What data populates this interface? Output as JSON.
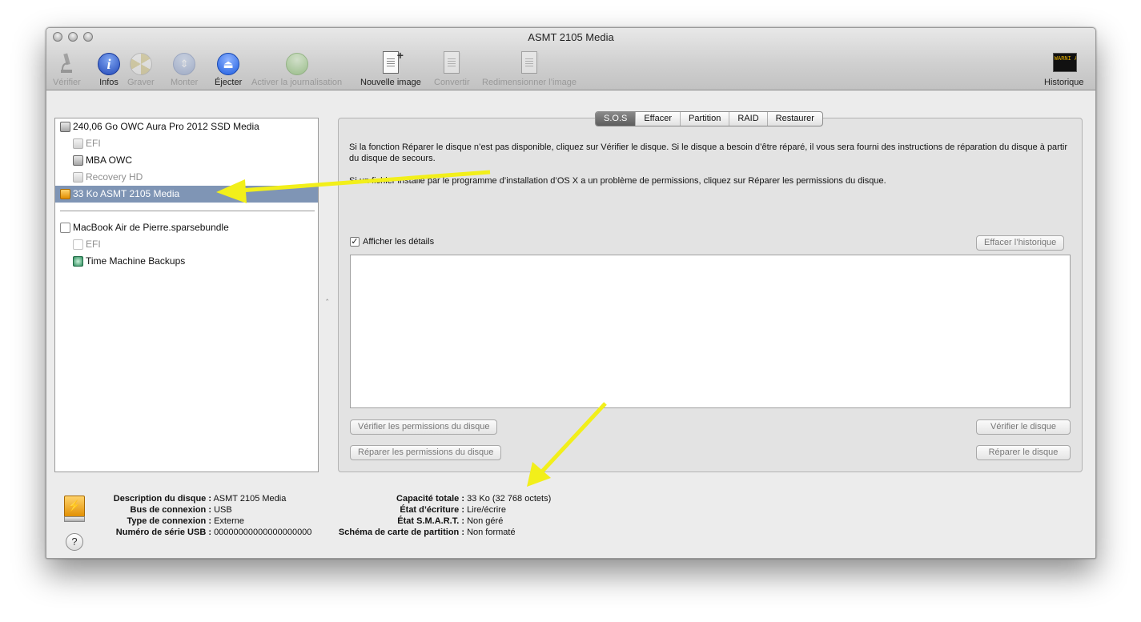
{
  "window": {
    "title": "ASMT 2105 Media"
  },
  "toolbar": {
    "verify": "Vérifier",
    "info": "Infos",
    "burn": "Graver",
    "mount": "Monter",
    "eject": "Éjecter",
    "journal": "Activer la journalisation",
    "new_image": "Nouvelle image",
    "convert": "Convertir",
    "resize": "Redimensionner l’image",
    "log": "Historique",
    "log_icon_text": "WARNI AY 7:36"
  },
  "sidebar": {
    "items": [
      {
        "label": "240,06 Go OWC Aura Pro 2012 SSD Media"
      },
      {
        "label": "EFI"
      },
      {
        "label": "MBA OWC"
      },
      {
        "label": "Recovery HD"
      },
      {
        "label": "33 Ko ASMT 2105 Media"
      },
      {
        "label": "MacBook Air de Pierre.sparsebundle"
      },
      {
        "label": "EFI"
      },
      {
        "label": "Time Machine Backups"
      }
    ]
  },
  "tabs": [
    "S.O.S",
    "Effacer",
    "Partition",
    "RAID",
    "Restaurer"
  ],
  "sos": {
    "help1": "Si la fonction Réparer le disque n’est pas disponible, cliquez sur Vérifier le disque. Si le disque a besoin d’être réparé, il vous sera fourni des instructions de réparation du disque à partir du disque de secours.",
    "help2": "Si un fichier installé par le programme d’installation d’OS X a un problème de permissions, cliquez sur Réparer les permissions du disque.",
    "show_details": "Afficher les détails",
    "show_details_checked": true,
    "clear_history": "Effacer l’historique",
    "verify_perms": "Vérifier les permissions du disque",
    "repair_perms": "Réparer les permissions du disque",
    "verify_disk": "Vérifier le disque",
    "repair_disk": "Réparer le disque"
  },
  "info": {
    "left": [
      {
        "k": "Description du disque :",
        "v": "ASMT 2105 Media"
      },
      {
        "k": "Bus de connexion :",
        "v": "USB"
      },
      {
        "k": "Type de connexion :",
        "v": "Externe"
      },
      {
        "k": "Numéro de série USB :",
        "v": "00000000000000000000"
      }
    ],
    "right": [
      {
        "k": "Capacité totale :",
        "v": "33 Ko (32 768 octets)"
      },
      {
        "k": "État d’écriture :",
        "v": "Lire/écrire"
      },
      {
        "k": "État S.M.A.R.T. :",
        "v": "Non géré"
      },
      {
        "k": "Schéma de carte de partition :",
        "v": "Non formaté"
      }
    ],
    "help": "?"
  },
  "colors": {
    "selection": "#7f95b5",
    "arrow": "#f2ef1a"
  }
}
